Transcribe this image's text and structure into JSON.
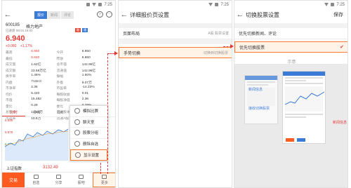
{
  "status": {
    "time": "7:25"
  },
  "p1": {
    "tabs": [
      "报价",
      "新闻",
      "评论"
    ],
    "stock_code": "600185",
    "stock_name": "格力地产",
    "market_status": "已收盘 06/15 16:00",
    "badges": [
      "融",
      "通"
    ],
    "price": "6.940",
    "change": "+0.080",
    "change_pct": "+1.17%",
    "quote": [
      [
        "最高",
        "6.950",
        "今开",
        "6.850"
      ],
      [
        "最低",
        "6.840",
        "昨收",
        "6.860"
      ],
      [
        "成交量",
        "1.62亿",
        "总市值",
        "142.96亿"
      ],
      [
        "成交额",
        "23.58万亿",
        "流通值",
        "142.96亿"
      ],
      [
        "换手率",
        "1.46%",
        "振幅",
        "1.60%"
      ],
      [
        "内盘",
        "7132.0",
        "外盘",
        "9.07万"
      ],
      [
        "市净率",
        "2.36",
        "市盈率",
        "-14.23%"
      ],
      [
        "均价",
        "5.440",
        "每股收益",
        "0.01"
      ],
      [
        "市值",
        "15.482",
        "每股净值",
        "2.36"
      ],
      [
        "量比",
        "0.29",
        "委比",
        "0.28%"
      ],
      [
        "总股本",
        "12.56万",
        "流通股本",
        "20.60亿"
      ],
      [
        "市盈率",
        "10.8万",
        "流通A股",
        "16.18亿"
      ]
    ],
    "chart_tabs": [
      "分时",
      "多日",
      "日K",
      "周K",
      "月K"
    ],
    "chart_y": [
      "6.930",
      "6.875",
      "6.817",
      "6.774"
    ],
    "index_label": "上证指数",
    "index_value": "3132.49",
    "nav": [
      "交易",
      "自选",
      "分享",
      "股吧",
      "更多"
    ],
    "menu": [
      "模拟比赛",
      "聊天室",
      "股票分组",
      "删除自选",
      "显示设置"
    ]
  },
  "p2": {
    "title": "详细报价页设置",
    "rows": [
      {
        "label": "页面布局",
        "value": "A股 股票设置"
      },
      {
        "label": "手势切换",
        "value": "切换到切换股票"
      }
    ]
  },
  "p3": {
    "title": "切换股票设置",
    "save": "保存",
    "options": [
      "优先切换新闻、评论",
      "优先切换股票"
    ],
    "preview_label": "示意",
    "preview_cap1": "新闻信息",
    "preview_cap2": "新闻信息",
    "preview_cap3": "接收切换股票"
  },
  "colors": {
    "accent": "#ff7a2e",
    "red": "#e53935",
    "blue": "#3b7bd8"
  }
}
